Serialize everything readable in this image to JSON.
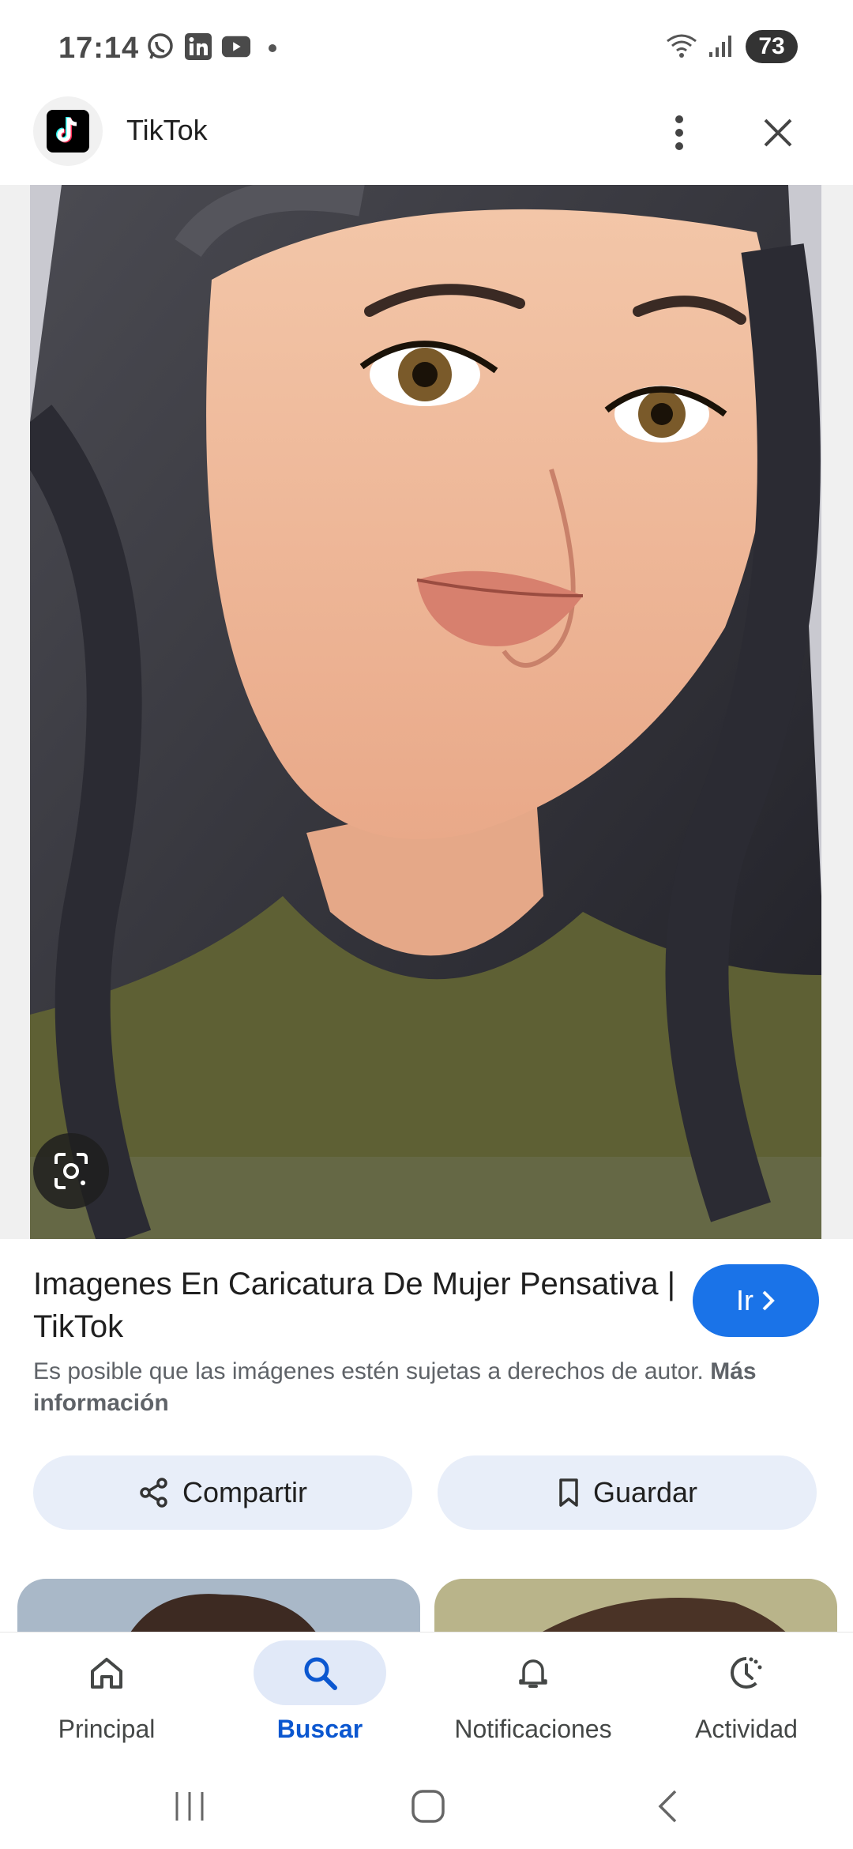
{
  "status_bar": {
    "time": "17:14",
    "apps": [
      "whatsapp-icon",
      "linkedin-icon",
      "youtube-icon"
    ],
    "battery": "73"
  },
  "header": {
    "site_name": "TikTok",
    "favicon": "tiktok-icon"
  },
  "result": {
    "title": "Imagenes En Caricatura De Mujer Pensativa | TikTok",
    "go_label": "Ir",
    "copyright_text": "Es posible que las imágenes estén sujetas a derechos de autor.",
    "more_info": "Más información"
  },
  "actions": {
    "share_label": "Compartir",
    "save_label": "Guardar"
  },
  "bottom_nav": {
    "items": [
      {
        "label": "Principal",
        "icon": "home-icon",
        "active": false
      },
      {
        "label": "Buscar",
        "icon": "search-icon",
        "active": true
      },
      {
        "label": "Notificaciones",
        "icon": "bell-icon",
        "active": false
      },
      {
        "label": "Actividad",
        "icon": "history-icon",
        "active": false
      }
    ]
  },
  "colors": {
    "accent": "#1a73e8",
    "active_nav": "#0b57d0",
    "chip_bg": "#e8eef9"
  }
}
